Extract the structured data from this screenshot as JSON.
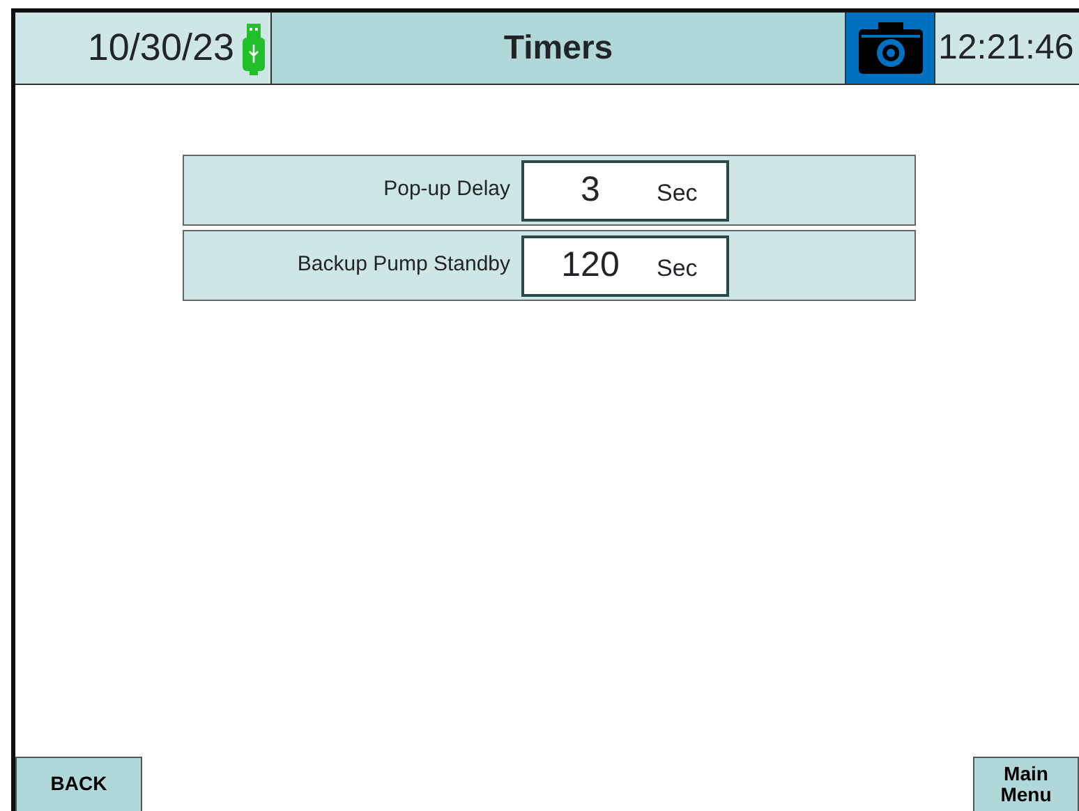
{
  "header": {
    "date": "10/30/23",
    "usb_connected": true,
    "title": "Timers",
    "time": "12:21:46"
  },
  "timers": [
    {
      "label": "Pop-up Delay",
      "value": "3",
      "unit": "Sec"
    },
    {
      "label": "Backup Pump Standby",
      "value": "120",
      "unit": "Sec"
    }
  ],
  "buttons": [
    {
      "label": "BACK",
      "kind": "left"
    },
    {
      "label": "Main Menu",
      "kind": "right"
    }
  ]
}
